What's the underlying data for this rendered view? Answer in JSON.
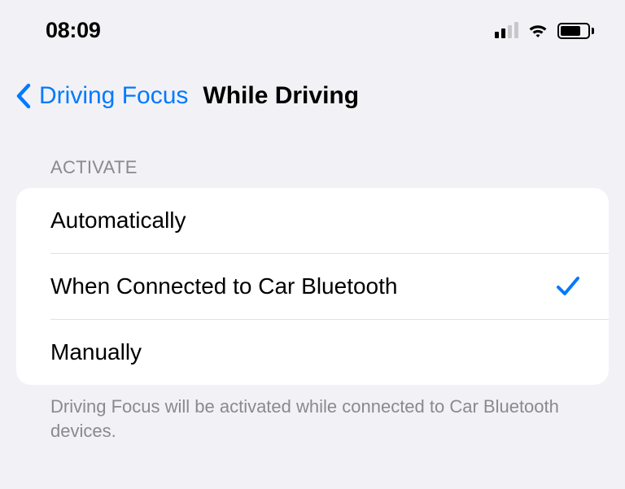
{
  "statusBar": {
    "time": "08:09"
  },
  "nav": {
    "backLabel": "Driving Focus",
    "title": "While Driving"
  },
  "section": {
    "header": "ACTIVATE",
    "footer": "Driving Focus will be activated while connected to Car Bluetooth devices."
  },
  "options": {
    "automatically": {
      "label": "Automatically",
      "selected": false
    },
    "bluetooth": {
      "label": "When Connected to Car Bluetooth",
      "selected": true
    },
    "manually": {
      "label": "Manually",
      "selected": false
    }
  },
  "colors": {
    "accent": "#007aff"
  }
}
